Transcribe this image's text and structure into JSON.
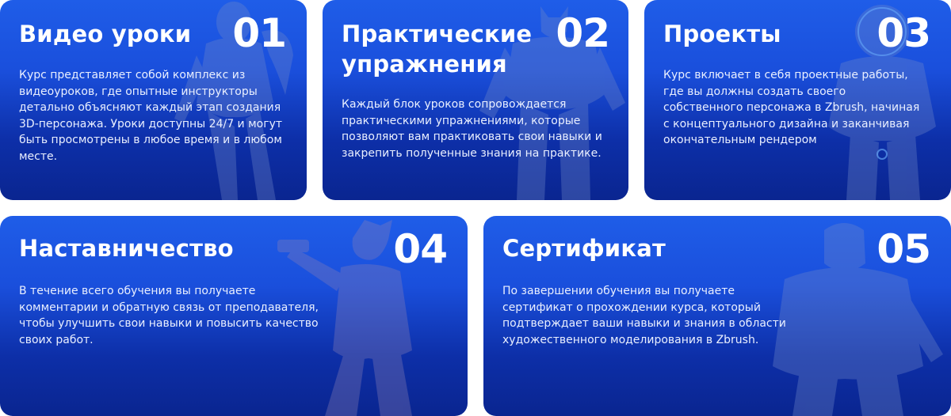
{
  "colors": {
    "card_top": "#1f5de8",
    "card_bottom": "#0a2590",
    "text": "#ffffff",
    "figure": "#6f86c9"
  },
  "cards": [
    {
      "title": "Видео уроки",
      "number": "01",
      "description": "Курс представляет собой комплекс из видеоуроков, где опытные инструкторы детально объясняют каждый этап создания 3D-персонажа. Уроки доступны 24/7 и могут быть просмотрены в любое время и в любом месте.",
      "illustration": "adventurer-figure"
    },
    {
      "title": "Практические упражнения",
      "number": "02",
      "description": "Каждый блок уроков сопровождается практическими упражнениями, которые позволяют вам практиковать свои навыки и закрепить полученные знания на практике.",
      "illustration": "armored-warrior-figure"
    },
    {
      "title": "Проекты",
      "number": "03",
      "description": "Курс включает в себя проектные работы, где вы должны создать своего собственного персонажа в Zbrush, начиная с концептуального дизайна и заканчивая окончательным рендером",
      "illustration": "astronaut-figure"
    },
    {
      "title": "Наставничество",
      "number": "04",
      "description": "В течение всего обучения вы получаете комментарии и обратную связь от преподавателя, чтобы улучшить свои навыки и повысить качество своих работ.",
      "illustration": "gunslinger-figure"
    },
    {
      "title": "Сертификат",
      "number": "05",
      "description": "По завершении обучения вы получаете сертификат о прохождении курса, который подтверждает ваши навыки и знания в области художественного моделирования в Zbrush.",
      "illustration": "viking-warrior-figure"
    }
  ]
}
